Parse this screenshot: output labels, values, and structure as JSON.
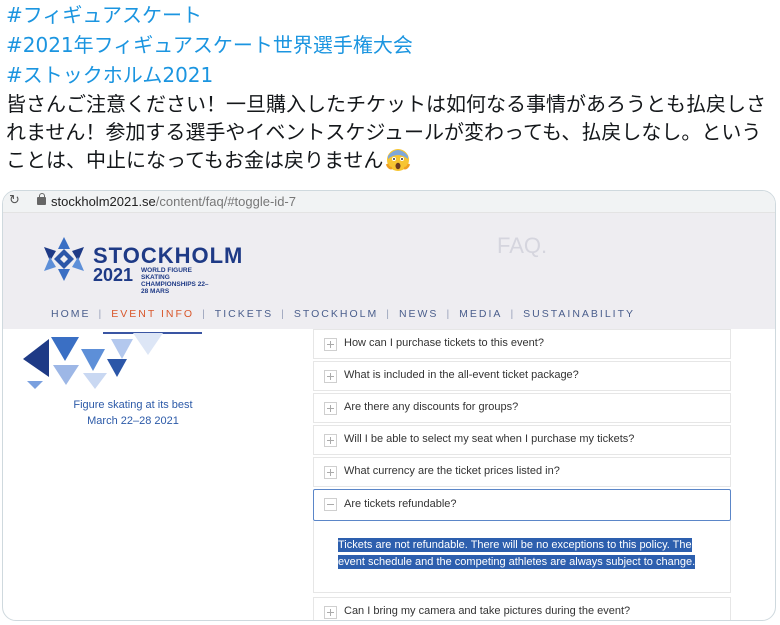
{
  "tweet": {
    "hashtags": [
      "#フィギュアスケート",
      "#2021年フィギュアスケート世界選手権大会",
      "#ストックホルム2021"
    ],
    "text": "皆さんご注意ください！一旦購入したチケットは如何なる事情があろうとも払戻しされません！参加する選手やイベントスケジュールが変わっても、払戻しなし。ということは、中止になってもお金は戻りません",
    "emoji_icon": "screaming-face-emoji"
  },
  "browser": {
    "url_domain": "stockholm2021.se",
    "url_path": "/content/faq/#toggle-id-7"
  },
  "site": {
    "brand_name": "STOCKHOLM",
    "brand_year": "2021",
    "brand_subtitle": "WORLD FIGURE SKATING CHAMPIONSHIPS 22–28 MARS",
    "page_title_ghost": "FAQ.",
    "nav": [
      "HOME",
      "EVENT INFO",
      "TICKETS",
      "STOCKHOLM",
      "NEWS",
      "MEDIA",
      "SUSTAINABILITY"
    ],
    "active_nav": "EVENT INFO",
    "tagline_line1": "Figure skating at its best",
    "tagline_line2": "March 22–28 2021",
    "accent_color": "#d9572b",
    "brand_color": "#1e3a86"
  },
  "faq": {
    "questions": [
      "How can I purchase tickets to this event?",
      "What is included in the all-event ticket package?",
      "Are there any discounts for groups?",
      "Will I be able to select my seat when I purchase my tickets?",
      "What currency are the ticket prices listed in?",
      "Are tickets refundable?",
      "Can I bring my camera and take pictures during the event?"
    ],
    "open_question": "Are tickets refundable?",
    "answer": "Tickets are not refundable. There will be no exceptions to this policy. The event schedule and the competing athletes are always subject to change."
  }
}
